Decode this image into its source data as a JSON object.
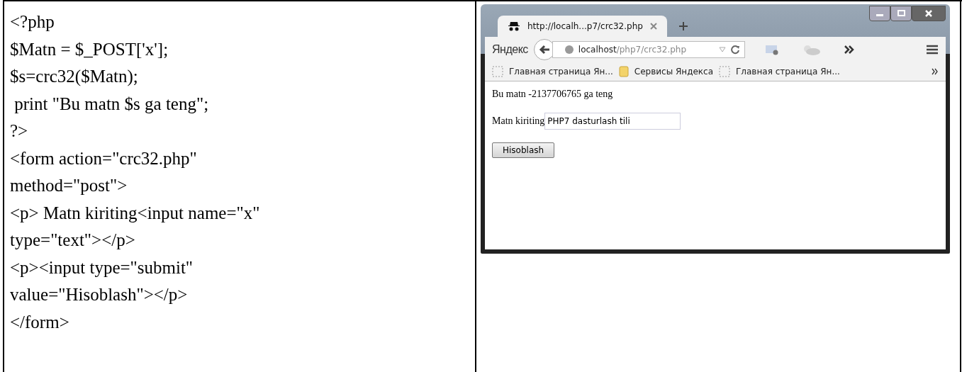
{
  "code_lines": [
    "<?php",
    "$Matn = $_POST['x'];",
    "$s=crc32($Matn);",
    " print \"Bu matn $s ga teng\";",
    "?>",
    "<form action=\"crc32.php\"",
    "method=\"post\">",
    "<p> Matn kiriting<input name=\"x\"",
    "type=\"text\"></p>",
    "<p><input type=\"submit\"",
    "value=\"Hisoblash\"></p>",
    "</form>"
  ],
  "browser": {
    "tabs": [
      {
        "title": "http://localh...p7/crc32.php",
        "selected": true
      }
    ],
    "brand": "Яндекс",
    "address": {
      "host": "localhost",
      "path": "/php7/crc32.php"
    },
    "bookmarks": [
      {
        "label": "Главная страница Ян...",
        "kind": "page"
      },
      {
        "label": "Сервисы Яндекса",
        "kind": "folder"
      },
      {
        "label": "Главная страница Ян...",
        "kind": "page"
      }
    ],
    "page": {
      "result": "Bu matn -2137706765 ga teng",
      "field_label": "Matn kiriting",
      "field_value": "PHP7 dasturlash tili",
      "button": "Hisoblash"
    }
  }
}
